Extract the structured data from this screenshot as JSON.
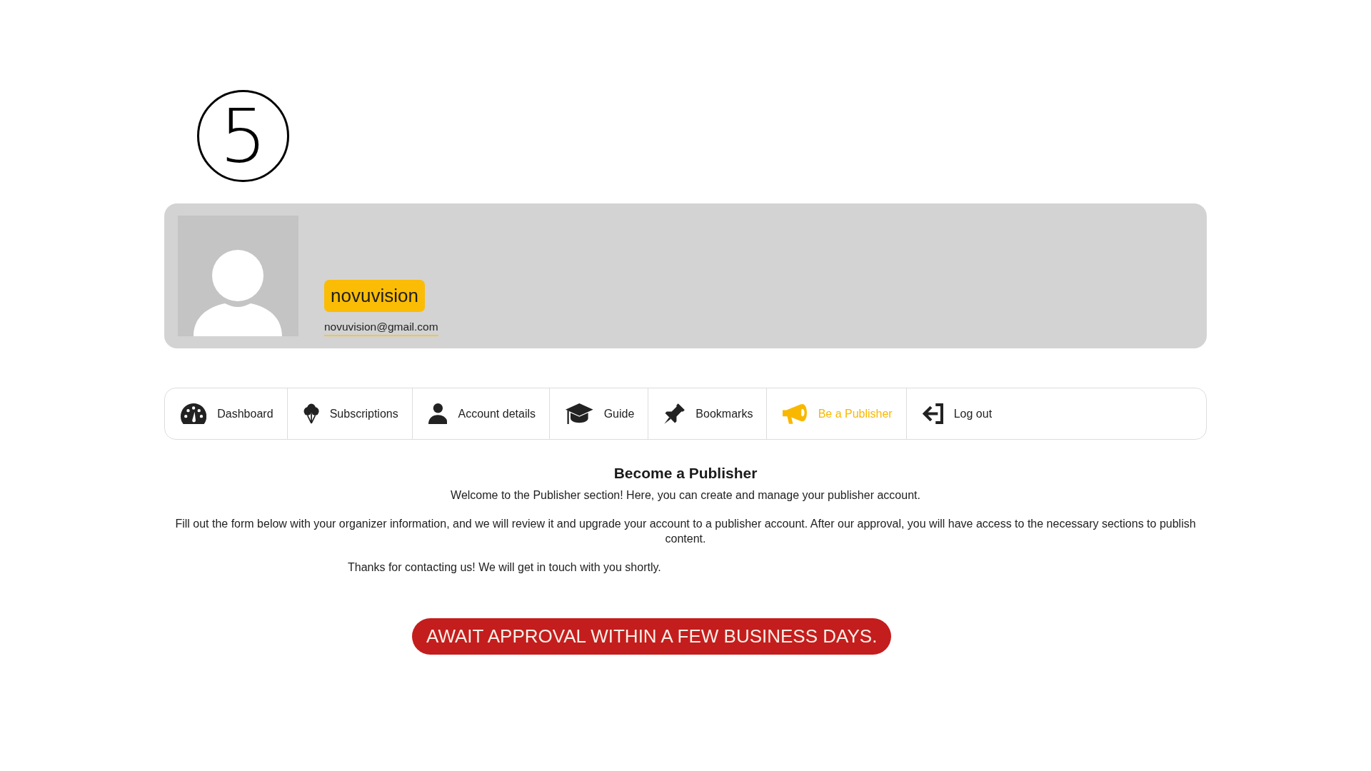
{
  "step_marker": "5",
  "profile": {
    "username": "novuvision",
    "email": "novuvision@gmail.com"
  },
  "tabs": [
    {
      "label": "Dashboard",
      "selected": false
    },
    {
      "label": "Subscriptions",
      "selected": false
    },
    {
      "label": "Account details",
      "selected": false
    },
    {
      "label": "Guide",
      "selected": false
    },
    {
      "label": "Bookmarks",
      "selected": false
    },
    {
      "label": "Be a Publisher",
      "selected": true
    },
    {
      "label": "Log out",
      "selected": false
    }
  ],
  "content": {
    "title": "Become a Publisher",
    "intro": "Welcome to the Publisher section! Here, you can create and manage your publisher account.",
    "description": "Fill out the form below with your organizer information, and we will review it and upgrade your account to a publisher account. After our approval, you will have access to the necessary sections to publish content.",
    "confirmation": "Thanks for contacting us! We will get in touch with you shortly.",
    "status_message": "AWAIT APPROVAL WITHIN A FEW BUSINESS DAYS."
  }
}
